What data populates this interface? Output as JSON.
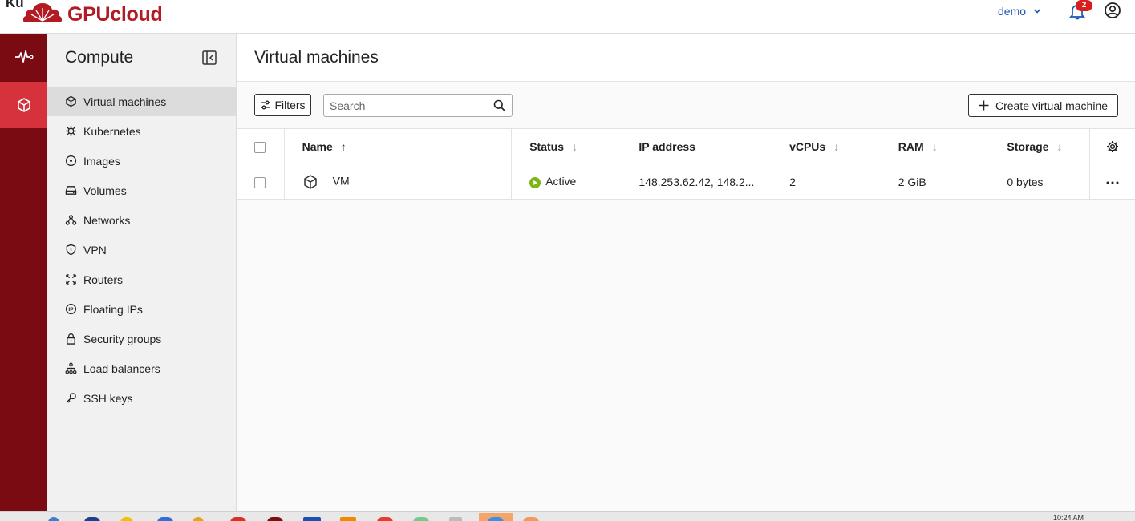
{
  "header": {
    "brand_prefix": "Ku",
    "brand_name": "GPUcloud",
    "user": "demo",
    "notifications_count": "2",
    "brand_color": "#b31b24"
  },
  "rail": {
    "items": [
      {
        "name": "monitoring",
        "icon": "pulse-icon"
      },
      {
        "name": "compute",
        "icon": "cube-icon",
        "active": true
      }
    ],
    "bg_color": "#7b0b13",
    "active_color": "#d6323c"
  },
  "subnav": {
    "title": "Compute",
    "items": [
      {
        "label": "Virtual machines",
        "icon": "cube-icon",
        "active": true
      },
      {
        "label": "Kubernetes",
        "icon": "helm-icon"
      },
      {
        "label": "Images",
        "icon": "disc-icon"
      },
      {
        "label": "Volumes",
        "icon": "drive-icon"
      },
      {
        "label": "Networks",
        "icon": "network-icon"
      },
      {
        "label": "VPN",
        "icon": "shield-icon"
      },
      {
        "label": "Routers",
        "icon": "router-icon"
      },
      {
        "label": "Floating IPs",
        "icon": "ip-icon"
      },
      {
        "label": "Security groups",
        "icon": "lock-icon"
      },
      {
        "label": "Load balancers",
        "icon": "hierarchy-icon"
      },
      {
        "label": "SSH keys",
        "icon": "key-icon"
      }
    ]
  },
  "main": {
    "title": "Virtual machines",
    "filters_label": "Filters",
    "search_placeholder": "Search",
    "create_label": "Create virtual machine",
    "columns": {
      "name": "Name",
      "status": "Status",
      "ip": "IP address",
      "vcpus": "vCPUs",
      "ram": "RAM",
      "storage": "Storage"
    },
    "rows": [
      {
        "name": "VM",
        "status": "Active",
        "ip": "148.253.62.42, 148.2...",
        "vcpus": "2",
        "ram": "2 GiB",
        "storage": "0 bytes",
        "status_color": "#7cb518"
      }
    ]
  },
  "taskbar": {
    "time": "10:24 AM"
  }
}
